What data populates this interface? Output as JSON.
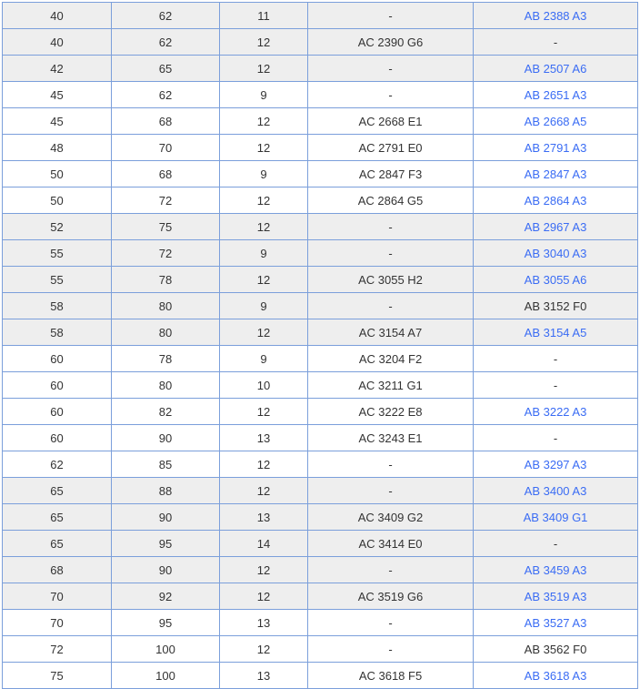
{
  "colors": {
    "link": "#3a6cf4",
    "text": "#333333",
    "border": "#7b9fdb",
    "shaded_row": "#eeeeee"
  },
  "rows": [
    {
      "shaded": true,
      "cells": [
        "40",
        "62",
        "11",
        "-"
      ],
      "ab": "AB 2388 A3",
      "ab_link": true
    },
    {
      "shaded": true,
      "cells": [
        "40",
        "62",
        "12",
        "AC 2390 G6"
      ],
      "ab": "-",
      "ab_link": false
    },
    {
      "shaded": true,
      "cells": [
        "42",
        "65",
        "12",
        "-"
      ],
      "ab": "AB 2507 A6",
      "ab_link": true
    },
    {
      "shaded": false,
      "cells": [
        "45",
        "62",
        "9",
        "-"
      ],
      "ab": "AB 2651 A3",
      "ab_link": true
    },
    {
      "shaded": false,
      "cells": [
        "45",
        "68",
        "12",
        "AC 2668 E1"
      ],
      "ab": "AB 2668 A5",
      "ab_link": true
    },
    {
      "shaded": false,
      "cells": [
        "48",
        "70",
        "12",
        "AC 2791 E0"
      ],
      "ab": "AB 2791 A3",
      "ab_link": true
    },
    {
      "shaded": false,
      "cells": [
        "50",
        "68",
        "9",
        "AC 2847 F3"
      ],
      "ab": "AB 2847 A3",
      "ab_link": true
    },
    {
      "shaded": false,
      "cells": [
        "50",
        "72",
        "12",
        "AC 2864 G5"
      ],
      "ab": "AB 2864 A3",
      "ab_link": true
    },
    {
      "shaded": true,
      "cells": [
        "52",
        "75",
        "12",
        "-"
      ],
      "ab": "AB 2967 A3",
      "ab_link": true
    },
    {
      "shaded": true,
      "cells": [
        "55",
        "72",
        "9",
        "-"
      ],
      "ab": "AB 3040 A3",
      "ab_link": true
    },
    {
      "shaded": true,
      "cells": [
        "55",
        "78",
        "12",
        "AC 3055 H2"
      ],
      "ab": "AB 3055 A6",
      "ab_link": true
    },
    {
      "shaded": true,
      "cells": [
        "58",
        "80",
        "9",
        "-"
      ],
      "ab": "AB 3152 F0",
      "ab_link": false
    },
    {
      "shaded": true,
      "cells": [
        "58",
        "80",
        "12",
        "AC 3154 A7"
      ],
      "ab": "AB 3154 A5",
      "ab_link": true
    },
    {
      "shaded": false,
      "cells": [
        "60",
        "78",
        "9",
        "AC 3204 F2"
      ],
      "ab": "-",
      "ab_link": false
    },
    {
      "shaded": false,
      "cells": [
        "60",
        "80",
        "10",
        "AC 3211 G1"
      ],
      "ab": "-",
      "ab_link": false
    },
    {
      "shaded": false,
      "cells": [
        "60",
        "82",
        "12",
        "AC 3222 E8"
      ],
      "ab": "AB 3222 A3",
      "ab_link": true
    },
    {
      "shaded": false,
      "cells": [
        "60",
        "90",
        "13",
        "AC 3243 E1"
      ],
      "ab": "-",
      "ab_link": false
    },
    {
      "shaded": false,
      "cells": [
        "62",
        "85",
        "12",
        "-"
      ],
      "ab": "AB 3297 A3",
      "ab_link": true
    },
    {
      "shaded": true,
      "cells": [
        "65",
        "88",
        "12",
        "-"
      ],
      "ab": "AB 3400 A3",
      "ab_link": true
    },
    {
      "shaded": true,
      "cells": [
        "65",
        "90",
        "13",
        "AC 3409 G2"
      ],
      "ab": "AB 3409 G1",
      "ab_link": true
    },
    {
      "shaded": true,
      "cells": [
        "65",
        "95",
        "14",
        "AC 3414 E0"
      ],
      "ab": "-",
      "ab_link": false
    },
    {
      "shaded": true,
      "cells": [
        "68",
        "90",
        "12",
        "-"
      ],
      "ab": "AB 3459 A3",
      "ab_link": true
    },
    {
      "shaded": true,
      "cells": [
        "70",
        "92",
        "12",
        "AC 3519 G6"
      ],
      "ab": "AB 3519 A3",
      "ab_link": true
    },
    {
      "shaded": false,
      "cells": [
        "70",
        "95",
        "13",
        "-"
      ],
      "ab": "AB 3527 A3",
      "ab_link": true
    },
    {
      "shaded": false,
      "cells": [
        "72",
        "100",
        "12",
        "-"
      ],
      "ab": "AB 3562 F0",
      "ab_link": false
    },
    {
      "shaded": false,
      "cells": [
        "75",
        "100",
        "13",
        "AC 3618 F5"
      ],
      "ab": "AB 3618 A3",
      "ab_link": true
    }
  ]
}
